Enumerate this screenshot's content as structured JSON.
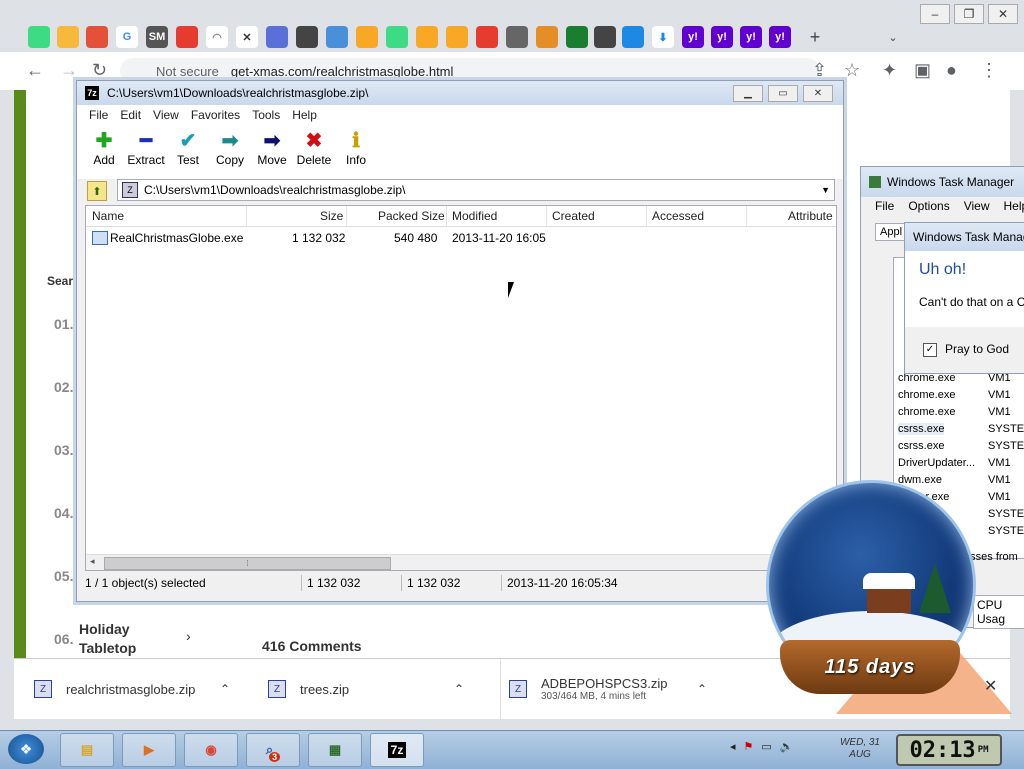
{
  "chrome": {
    "tab_close": "✕",
    "new_tab": "+",
    "not_secure": "Not secure",
    "url": "get-xmas.com/realchristmasglobe.html"
  },
  "page": {
    "search_label": "Sear",
    "numbers": [
      "01.",
      "02.",
      "03.",
      "04.",
      "05.",
      "06."
    ],
    "holiday": "Holiday Tabletop",
    "comments": "416 Comments"
  },
  "downloads": [
    {
      "name": "realchristmasglobe.zip"
    },
    {
      "name": "trees.zip"
    },
    {
      "name": "ADBEPOHSPCS3.zip",
      "sub": "303/464 MB, 4 mins left"
    }
  ],
  "zip": {
    "title": "C:\\Users\\vm1\\Downloads\\realchristmasglobe.zip\\",
    "menu": [
      "File",
      "Edit",
      "View",
      "Favorites",
      "Tools",
      "Help"
    ],
    "tools": [
      {
        "label": "Add",
        "glyph": "✚",
        "color": "#1fa81f"
      },
      {
        "label": "Extract",
        "glyph": "━",
        "color": "#1f2fb4"
      },
      {
        "label": "Test",
        "glyph": "✔",
        "color": "#1b9fb5"
      },
      {
        "label": "Copy",
        "glyph": "➡",
        "color": "#1b8a8f"
      },
      {
        "label": "Move",
        "glyph": "➡",
        "color": "#101070"
      },
      {
        "label": "Delete",
        "glyph": "✖",
        "color": "#d01010"
      },
      {
        "label": "Info",
        "glyph": "ℹ",
        "color": "#c9a000"
      }
    ],
    "address": "C:\\Users\\vm1\\Downloads\\realchristmasglobe.zip\\",
    "columns": [
      "Name",
      "Size",
      "Packed Size",
      "Modified",
      "Created",
      "Accessed",
      "Attribute"
    ],
    "row": {
      "name": "RealChristmasGlobe.exe",
      "size": "1 132 032",
      "packed": "540 480",
      "modified": "2013-11-20 16:05"
    },
    "status": {
      "selected": "1 / 1 object(s) selected",
      "size": "1 132 032",
      "packed": "1 132 032",
      "modified": "2013-11-20 16:05:34"
    }
  },
  "taskmgr": {
    "title": "Windows Task Manager",
    "menu": [
      "File",
      "Options",
      "View",
      "Help"
    ],
    "tab": "Appl",
    "processes": [
      {
        "name": "chrome.exe",
        "user": "VM1"
      },
      {
        "name": "chrome.exe",
        "user": "VM1"
      },
      {
        "name": "chrome.exe",
        "user": "VM1"
      },
      {
        "name": "csrss.exe",
        "user": "SYSTEM"
      },
      {
        "name": "csrss.exe",
        "user": "SYSTEM"
      },
      {
        "name": "DriverUpdater...",
        "user": "VM1"
      },
      {
        "name": "dwm.exe",
        "user": "VM1"
      },
      {
        "name": "...lorer.exe",
        "user": "VM1"
      },
      {
        "name": "",
        "user": "SYSTEM"
      },
      {
        "name": "",
        "user": "SYSTEM"
      }
    ],
    "all_procs": "...sses from all",
    "cpu": "CPU Usag"
  },
  "dialog": {
    "title": "Windows Task Manag",
    "heading": "Uh oh!",
    "message": "Can't do that on a C",
    "checkbox": "Pray to God",
    "check_glyph": "✓"
  },
  "globe": {
    "days": "115 days"
  },
  "taskbar": {
    "items": [
      "",
      "",
      "",
      "3",
      "",
      "7z"
    ],
    "date_line1": "WED, 31",
    "date_line2": "AUG",
    "time": "02:13",
    "ampm": "PM"
  }
}
